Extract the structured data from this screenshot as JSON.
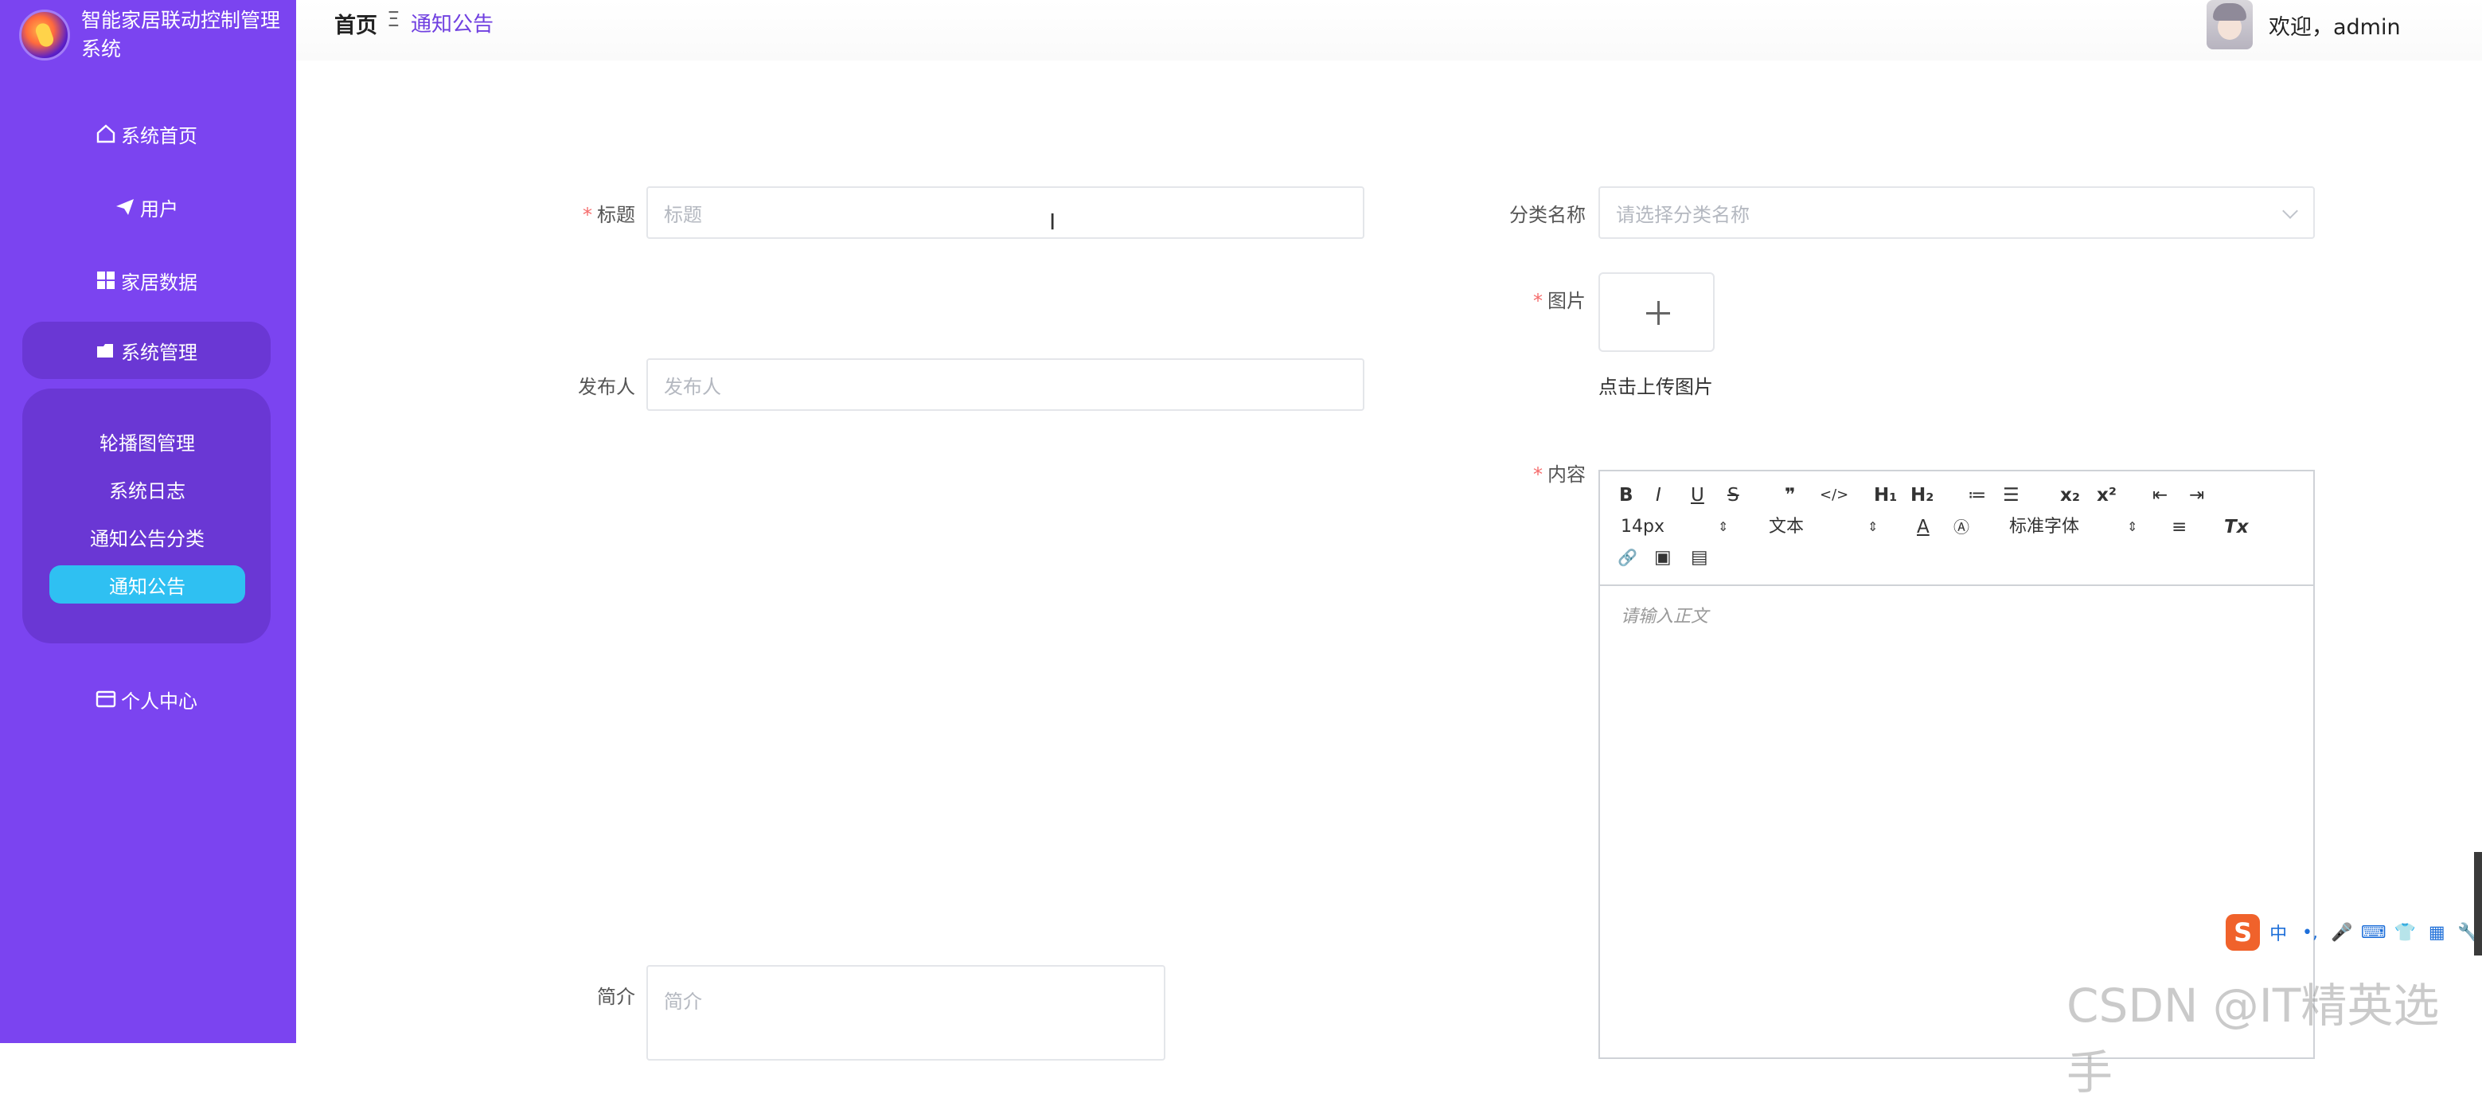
{
  "app": {
    "title": "智能家居联动控制管理系统"
  },
  "sidebar": {
    "items": [
      {
        "label": "系统首页",
        "icon": "home-icon"
      },
      {
        "label": "用户",
        "icon": "paper-plane-icon"
      },
      {
        "label": "家居数据",
        "icon": "grid-icon"
      },
      {
        "label": "系统管理",
        "icon": "folder-icon"
      },
      {
        "label": "个人中心",
        "icon": "id-card-icon"
      }
    ],
    "submenu": [
      {
        "label": "轮播图管理"
      },
      {
        "label": "系统日志"
      },
      {
        "label": "通知公告分类"
      },
      {
        "label": "通知公告"
      }
    ],
    "active_item": "系统管理",
    "active_subitem": "通知公告"
  },
  "header": {
    "breadcrumb_home": "首页",
    "breadcrumb_separator": "Ξ",
    "breadcrumb_current": "通知公告",
    "welcome": "欢迎，admin"
  },
  "form": {
    "title": {
      "label": "标题",
      "required_mark": "*",
      "placeholder": "标题",
      "value": ""
    },
    "category": {
      "label": "分类名称",
      "placeholder": "请选择分类名称",
      "value": ""
    },
    "image": {
      "label": "图片",
      "required_mark": "*",
      "upload_text": "点击上传图片",
      "plus": "+"
    },
    "publisher": {
      "label": "发布人",
      "placeholder": "发布人",
      "value": ""
    },
    "content": {
      "label": "内容",
      "required_mark": "*",
      "placeholder": "请输入正文"
    },
    "summary": {
      "label": "简介",
      "placeholder": "简介",
      "value": ""
    }
  },
  "editor": {
    "toolbar": {
      "bold": "B",
      "italic": "I",
      "underline": "U",
      "strike": "S",
      "blockquote": "❞",
      "code": "</>",
      "h1": "H₁",
      "h2": "H₂",
      "ordered_list": "≔",
      "bullet_list": "☰",
      "subscript": "x₂",
      "superscript": "x²",
      "outdent": "⇤",
      "indent": "⇥",
      "font_size": "14px",
      "header_select": "文本",
      "font_color": "A",
      "background_color": "Ⓐ",
      "font_family": "标准字体",
      "align": "≡",
      "clean": "Tx",
      "link": "🔗",
      "image": "▣",
      "video": "▤",
      "select_caret": "⇕"
    }
  },
  "ime": {
    "logo": "S",
    "items": [
      "中",
      "•,",
      "🎤",
      "⌨",
      "👕",
      "▦",
      "🔧"
    ]
  },
  "watermark": "CSDN @IT精英选手",
  "colors": {
    "sidebar_bg": "#7b44f0",
    "submenu_bg": "#6a37d4",
    "active_sub_bg": "#2fc0f2",
    "breadcrumb_active": "#6f3fe0",
    "required": "#f56c6c"
  }
}
